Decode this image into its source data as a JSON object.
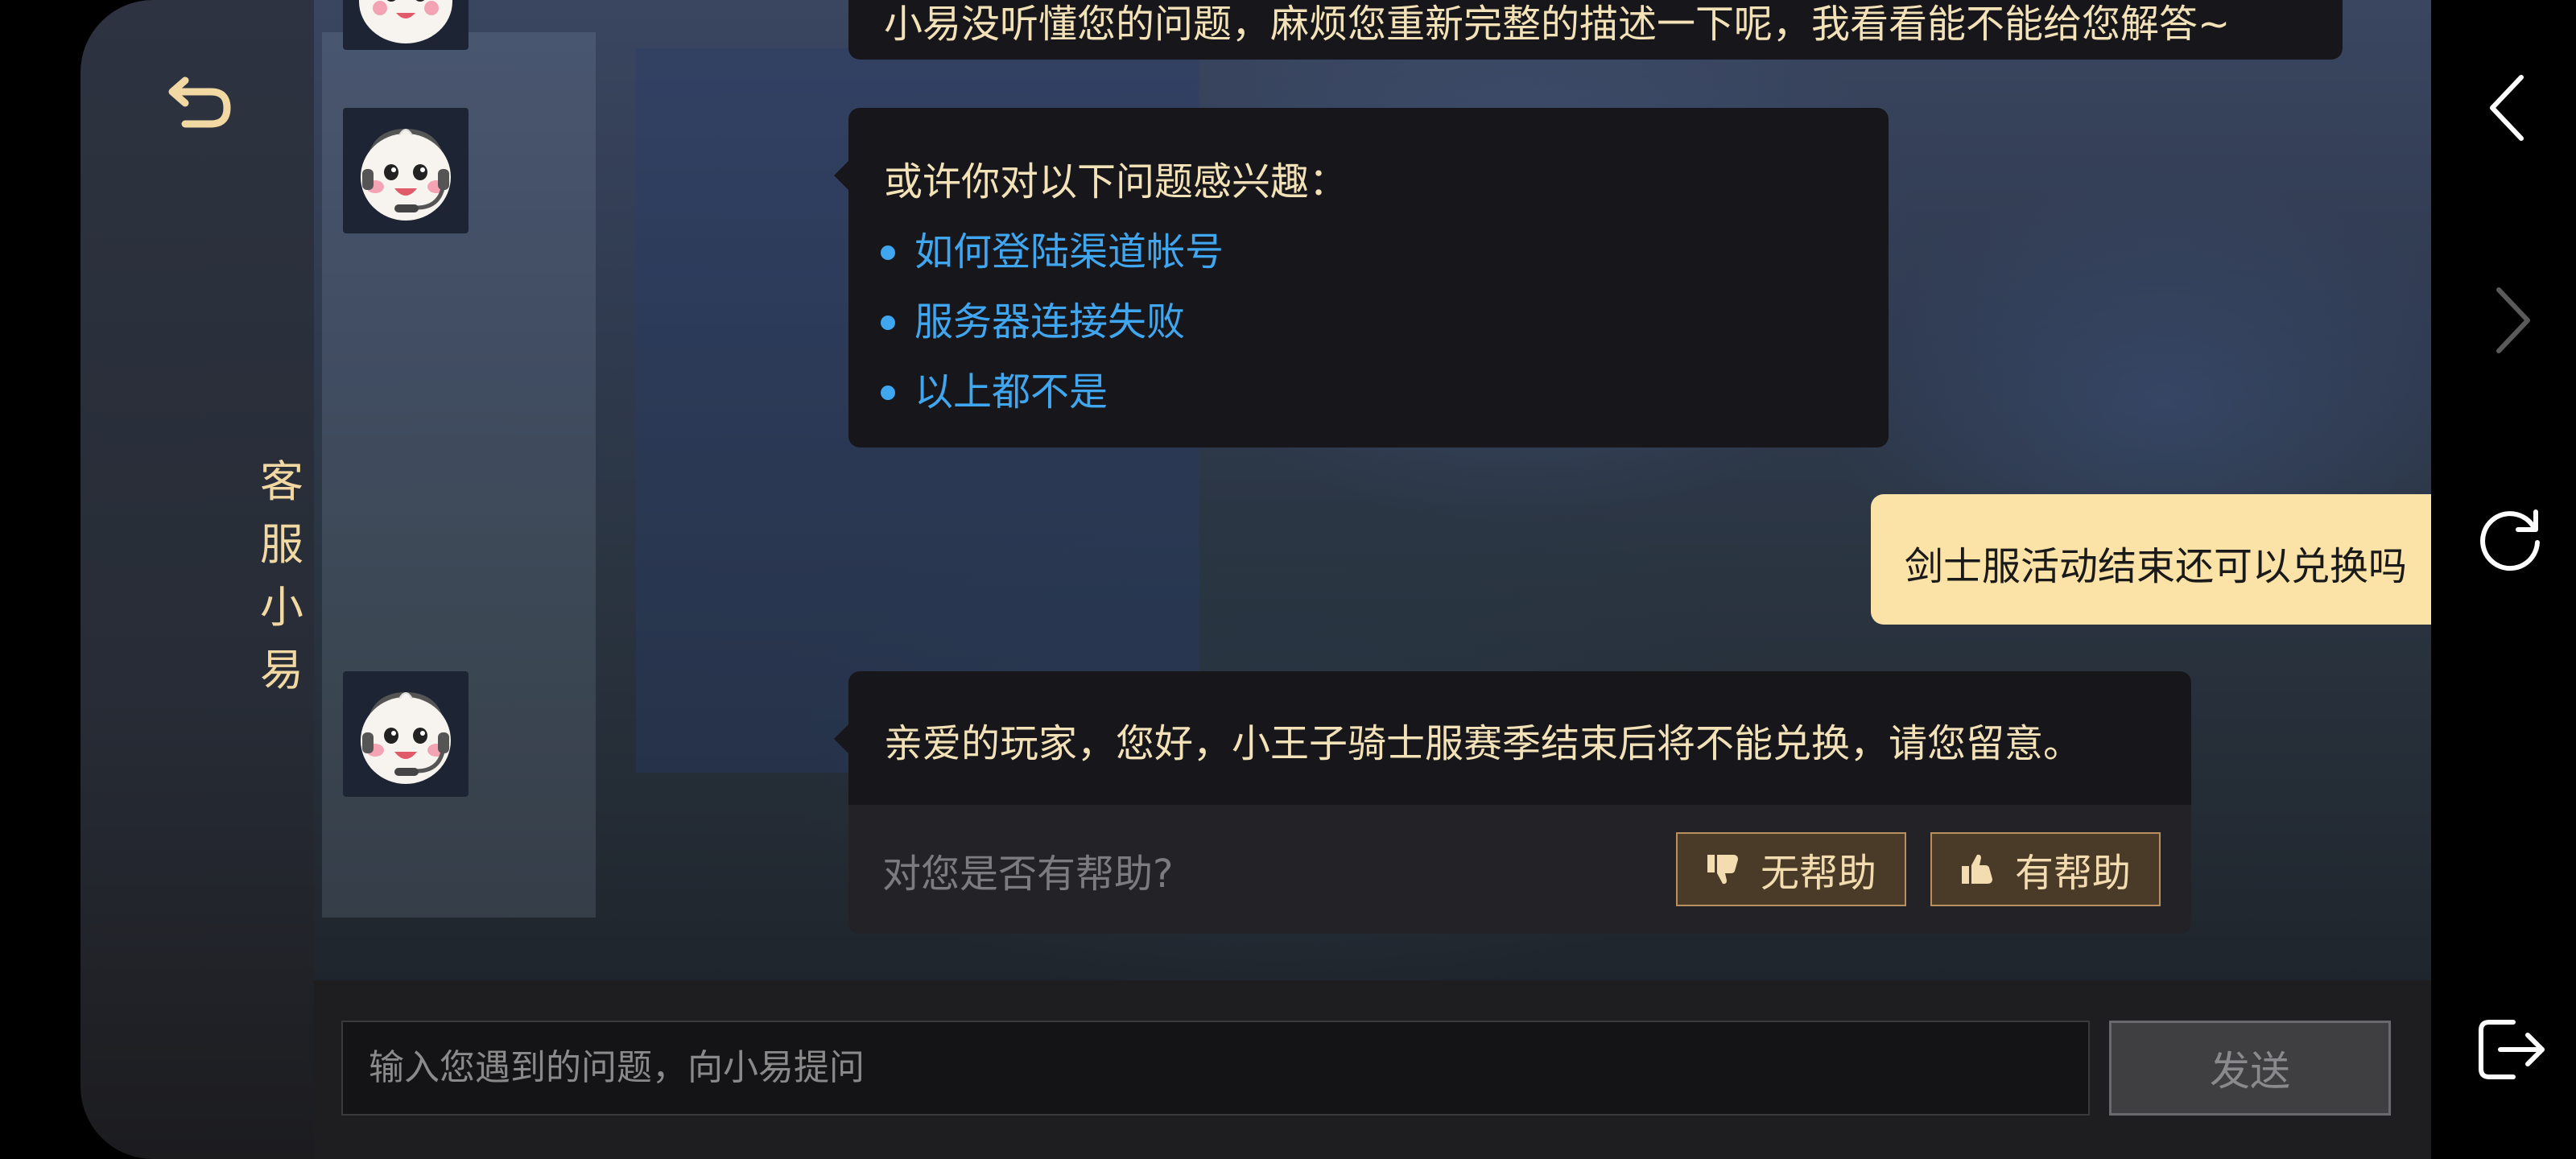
{
  "sidebar": {
    "title": "客服小易"
  },
  "messages": {
    "bot_partial": "小易没听懂您的问题，麻烦您重新完整的描述一下呢，我看看能不能给您解答~",
    "suggest_title": "或许你对以下问题感兴趣：",
    "suggestions": [
      "如何登陆渠道帐号",
      "服务器连接失败",
      "以上都不是"
    ],
    "user_message": "剑士服活动结束还可以兑换吗",
    "bot_answer": "亲爱的玩家，您好，小王子骑士服赛季结束后将不能兑换，请您留意。"
  },
  "feedback": {
    "question": "对您是否有帮助?",
    "no_label": "无帮助",
    "yes_label": "有帮助"
  },
  "input": {
    "placeholder": "输入您遇到的问题，向小易提问",
    "send_label": "发送"
  },
  "colors": {
    "accent_gold": "#f2d8a2",
    "link_blue": "#3fa6ef",
    "user_bubble": "#fbe2a6"
  }
}
